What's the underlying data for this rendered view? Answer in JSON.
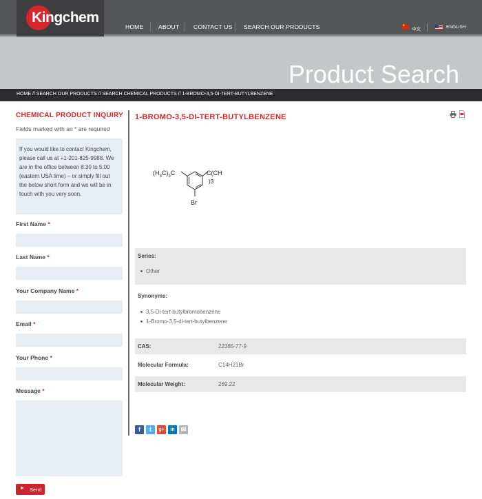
{
  "brand": {
    "logo_text": "Kingchem",
    "accent": "#d9262c"
  },
  "nav": {
    "items": [
      {
        "label": "HOME"
      },
      {
        "label": "ABOUT"
      },
      {
        "label": "CONTACT US"
      },
      {
        "label": "SEARCH OUR PRODUCTS"
      }
    ],
    "languages": [
      {
        "label": "中文",
        "icon": "china-flag-icon"
      },
      {
        "label": "ENGLISH",
        "icon": "us-flag-icon"
      }
    ]
  },
  "hero": {
    "title": "Product Search"
  },
  "breadcrumb": "HOME // SEARCH OUR PRODUCTS // SEARCH CHEMICAL PRODUCTS // 1-BROMO-3,5-DI-TERT-BUTYLBENZENE",
  "sidebar": {
    "title": "CHEMICAL PRODUCT INQUIRY",
    "note_pre": "Fields marked with an ",
    "note_star": "*",
    "note_post": " are required",
    "info": "If you would like to contact Kingchem, please call us at +1-201-825-9988. We are in the office between 8:30 to 5:00 (eastern USA time) – or simply fill out the below short form and we will be in touch with you very soon.",
    "fields": [
      {
        "label": "First Name",
        "star": "*"
      },
      {
        "label": "Last Name",
        "star": "*"
      },
      {
        "label": "Your Company Name",
        "star": "*"
      },
      {
        "label": "Email",
        "star": "*"
      },
      {
        "label": "Your Phone",
        "star": "*"
      },
      {
        "label": "Message",
        "star": "*"
      }
    ],
    "send_label": "Send"
  },
  "product": {
    "title": "1-BROMO-3,5-DI-TERT-BUTYLBENZENE",
    "structure": {
      "left_group": "(H",
      "left_sub1": "3",
      "left_mid": "C)",
      "left_sub2": "3",
      "left_end": "C",
      "right_top": "C(CH",
      "right_bottom": "3",
      "right_sub": ")3",
      "bottom": "Br"
    },
    "series_label": "Series:",
    "series": [
      "Other"
    ],
    "synonyms_label": "Synonyms:",
    "synonyms": [
      "3,5-Di-tert-butylbromobenzene",
      "1-Bromo-3,5-di-tert-butylbenzene"
    ],
    "props": [
      {
        "label": "CAS:",
        "value": "22385-77-9"
      },
      {
        "label": "Molecular Formula:",
        "value": "C14H21Br"
      },
      {
        "label": "Molecular Weight:",
        "value": "269.22"
      }
    ]
  },
  "social": [
    {
      "icon": "facebook-icon",
      "glyph": "f",
      "color": "#3b5998"
    },
    {
      "icon": "twitter-icon",
      "glyph": "t",
      "color": "#55acee"
    },
    {
      "icon": "google-plus-icon",
      "glyph": "g+",
      "color": "#dd4b39"
    },
    {
      "icon": "linkedin-icon",
      "glyph": "in",
      "color": "#0077b5"
    },
    {
      "icon": "email-icon",
      "glyph": "✉",
      "color": "#b5b5b5"
    }
  ]
}
